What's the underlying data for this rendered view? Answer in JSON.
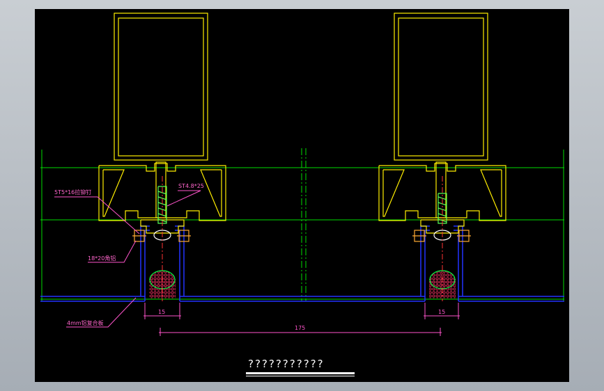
{
  "drawing": {
    "labels": {
      "rivet": "5T5*16拉铆钉",
      "screw": "ST4.8*25",
      "angle": "18*20角铝",
      "panel": "4mm铝复合板"
    },
    "dimensions": {
      "left_gap": "15",
      "right_gap": "15",
      "span": "175"
    },
    "title": "???????????"
  },
  "colors": {
    "background": "#000000",
    "frame": "#ffff00",
    "grid": "#00ff00",
    "panel": "#2222ff",
    "annotation": "#ff55cc",
    "divider": "#ffffff"
  }
}
